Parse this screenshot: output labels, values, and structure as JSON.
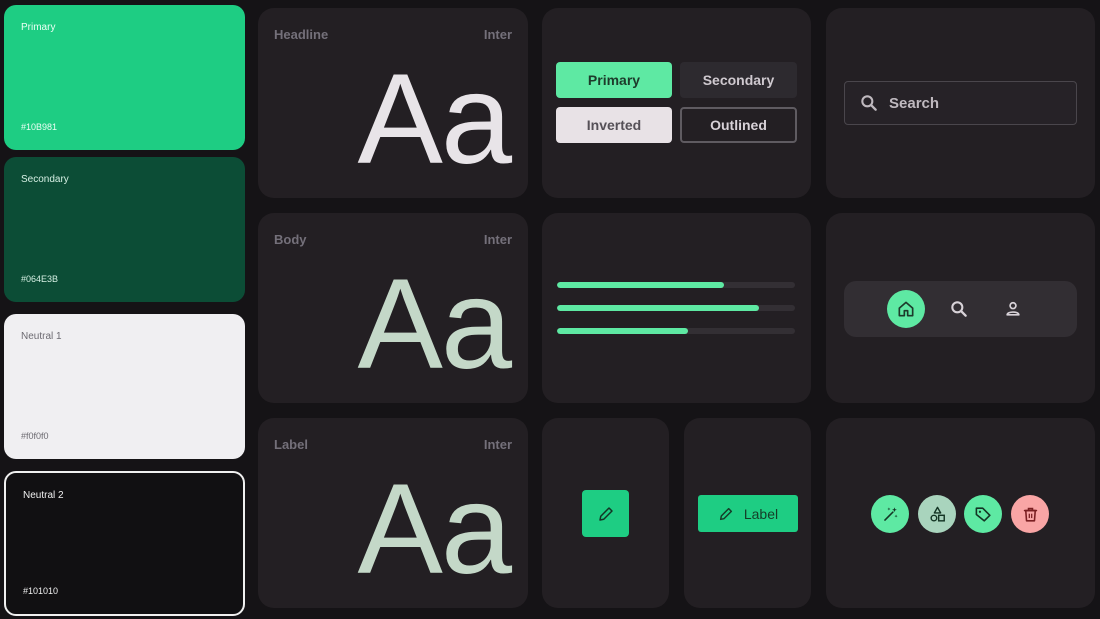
{
  "swatches": {
    "primary": {
      "name": "Primary",
      "hex": "#10B981"
    },
    "secondary": {
      "name": "Secondary",
      "hex": "#064E3B"
    },
    "neutral1": {
      "name": "Neutral 1",
      "hex": "#f0f0f0"
    },
    "neutral2": {
      "name": "Neutral 2",
      "hex": "#101010"
    }
  },
  "typography": {
    "headline": {
      "label": "Headline",
      "font": "Inter",
      "sample": "Aa"
    },
    "body": {
      "label": "Body",
      "font": "Inter",
      "sample": "Aa"
    },
    "label": {
      "label": "Label",
      "font": "Inter",
      "sample": "Aa"
    }
  },
  "buttons": {
    "primary": "Primary",
    "secondary": "Secondary",
    "inverted": "Inverted",
    "outlined": "Outlined"
  },
  "search": {
    "placeholder": "Search",
    "icon": "search-icon"
  },
  "progress": [
    0.7,
    0.85,
    0.55
  ],
  "nav": {
    "items": [
      "home-icon",
      "search-icon",
      "user-icon"
    ],
    "active": "home"
  },
  "icon_button": {
    "icon": "pencil-icon"
  },
  "label_button": {
    "icon": "pencil-icon",
    "label": "Label"
  },
  "fabs": [
    "magic-wand-icon",
    "shapes-icon",
    "tag-icon",
    "trash-icon"
  ],
  "colors": {
    "accent": "#5ee9a3",
    "primary": "#1ecd83",
    "danger": "#f9a5a5",
    "card": "#231f23",
    "background": "#151316"
  }
}
